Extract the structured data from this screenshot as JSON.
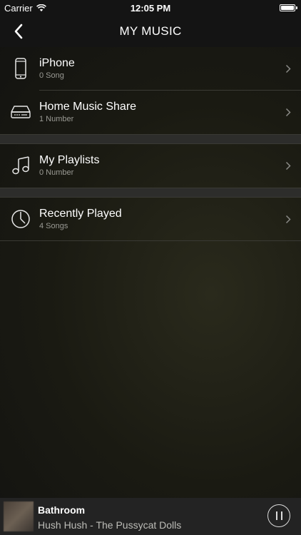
{
  "status_bar": {
    "carrier": "Carrier",
    "time": "12:05 PM",
    "wifi_icon": "wifi-icon",
    "battery_level": 1.0
  },
  "header": {
    "title": "MY MUSIC",
    "back_icon": "chevron-left-icon"
  },
  "sections": [
    {
      "items": [
        {
          "title": "iPhone",
          "subtitle": "0 Song",
          "icon": "iphone-icon"
        },
        {
          "title": "Home Music Share",
          "subtitle": "1 Number",
          "icon": "network-storage-icon"
        }
      ]
    },
    {
      "items": [
        {
          "title": "My Playlists",
          "subtitle": "0 Number",
          "icon": "music-note-icon"
        }
      ]
    },
    {
      "items": [
        {
          "title": "Recently Played",
          "subtitle": "4 Songs",
          "icon": "clock-icon"
        }
      ]
    }
  ],
  "now_playing": {
    "title": "Bathroom",
    "subtitle": "Hush Hush - The Pussycat Dolls",
    "pause_icon": "pause-icon"
  },
  "colors": {
    "background": "#141414",
    "divider": "#3a3a34",
    "subtitle_text": "#9a9a94",
    "player_bar": "#232323"
  }
}
